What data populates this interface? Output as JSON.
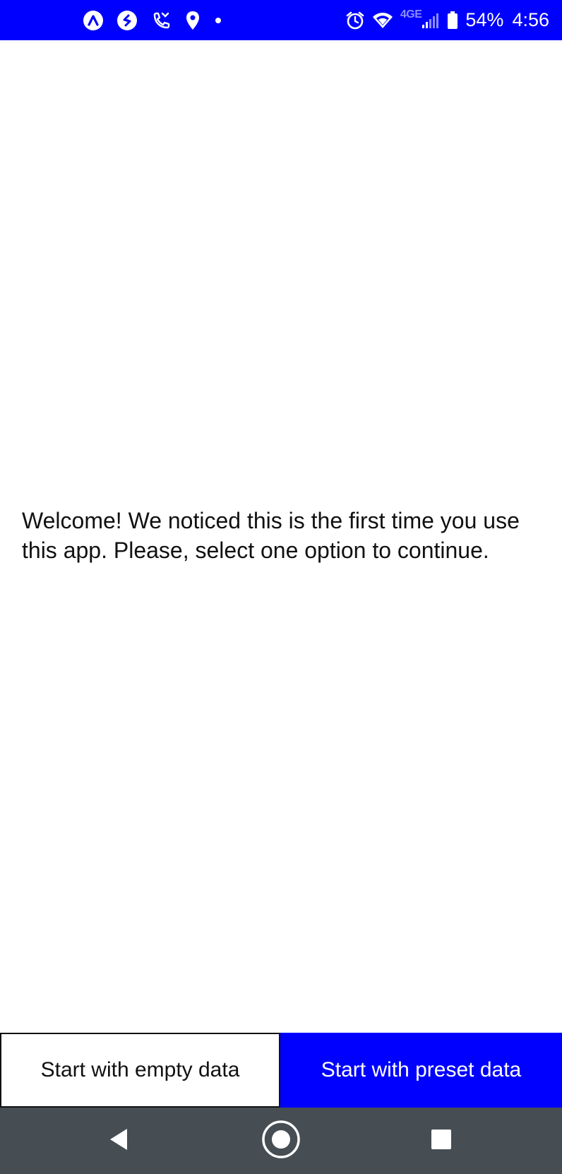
{
  "status_bar": {
    "background": "#0000ff",
    "left_icons": [
      "app-a-icon",
      "shazam-icon",
      "phone-missed-icon",
      "location-icon",
      "dot-icon"
    ],
    "right_icons": [
      "alarm-icon",
      "wifi-icon",
      "signal-icon",
      "battery-icon"
    ],
    "network_label": "4GE",
    "battery_percent": "54%",
    "time": "4:56"
  },
  "main": {
    "welcome_message": "Welcome! We noticed this is the first time you use this app. Please, select one option to continue."
  },
  "buttons": {
    "empty_label": "Start with empty data",
    "preset_label": "Start with preset data",
    "preset_color": "#0000ff"
  },
  "nav_bar": {
    "background": "#464e53",
    "icons": [
      "back-icon",
      "home-icon",
      "recents-icon"
    ]
  }
}
